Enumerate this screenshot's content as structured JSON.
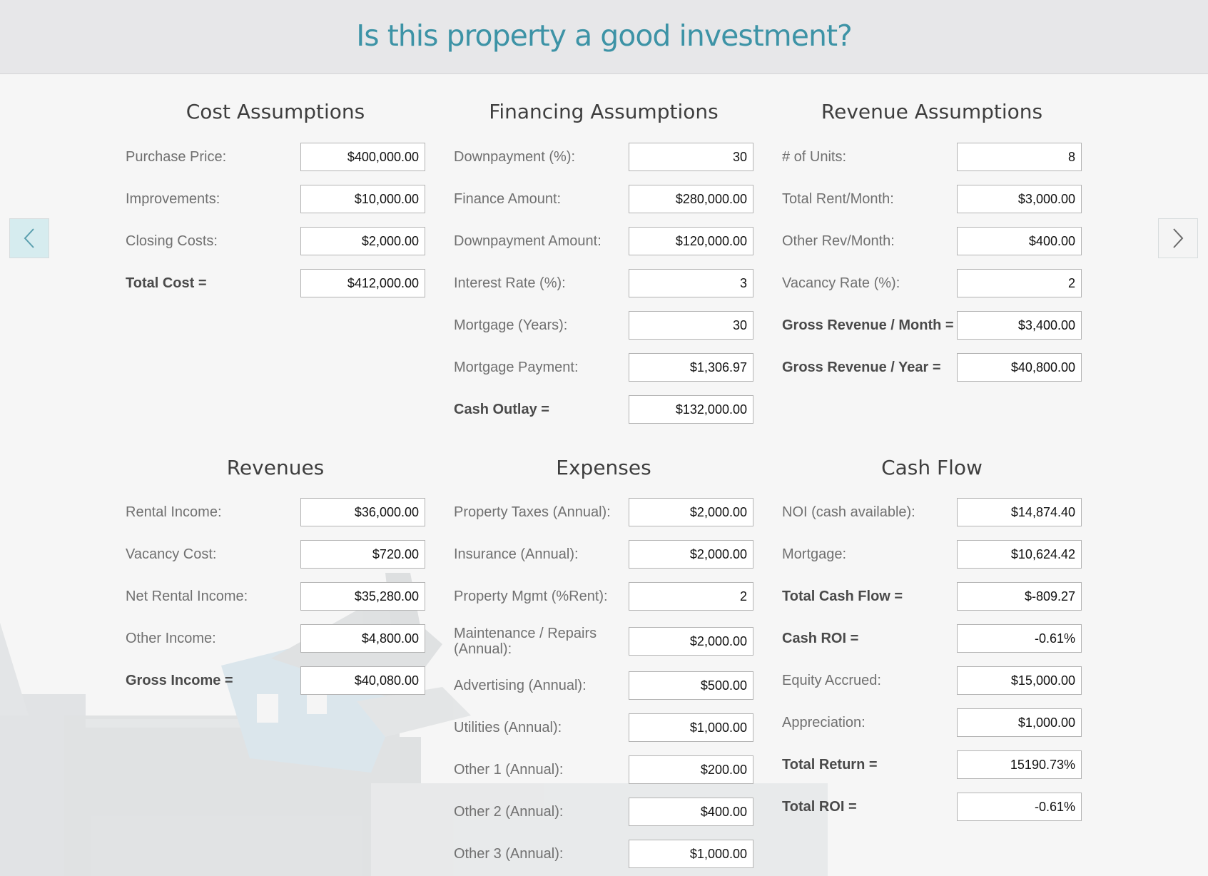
{
  "header": {
    "title": "Is this property a good investment?"
  },
  "cost": {
    "title": "Cost Assumptions",
    "rows": [
      {
        "label": "Purchase Price:",
        "value": "$400,000.00"
      },
      {
        "label": "Improvements:",
        "value": "$10,000.00"
      },
      {
        "label": "Closing Costs:",
        "value": "$2,000.00"
      },
      {
        "label": "Total Cost =",
        "value": "$412,000.00"
      }
    ]
  },
  "financing": {
    "title": "Financing Assumptions",
    "rows": [
      {
        "label": "Downpayment (%):",
        "value": "30"
      },
      {
        "label": "Finance Amount:",
        "value": "$280,000.00"
      },
      {
        "label": "Downpayment Amount:",
        "value": "$120,000.00"
      },
      {
        "label": "Interest Rate (%):",
        "value": "3"
      },
      {
        "label": "Mortgage (Years):",
        "value": "30"
      },
      {
        "label": "Mortgage Payment:",
        "value": "$1,306.97"
      },
      {
        "label": "Cash Outlay =",
        "value": "$132,000.00"
      }
    ]
  },
  "revenue_assumptions": {
    "title": "Revenue Assumptions",
    "rows": [
      {
        "label": "# of Units:",
        "value": "8"
      },
      {
        "label": "Total Rent/Month:",
        "value": "$3,000.00"
      },
      {
        "label": "Other Rev/Month:",
        "value": "$400.00"
      },
      {
        "label": "Vacancy Rate (%):",
        "value": "2"
      },
      {
        "label": "Gross Revenue / Month =",
        "value": "$3,400.00"
      },
      {
        "label": "Gross Revenue / Year =",
        "value": "$40,800.00"
      }
    ]
  },
  "revenues": {
    "title": "Revenues",
    "rows": [
      {
        "label": "Rental Income:",
        "value": "$36,000.00"
      },
      {
        "label": "Vacancy Cost:",
        "value": "$720.00"
      },
      {
        "label": "Net Rental Income:",
        "value": "$35,280.00"
      },
      {
        "label": "Other Income:",
        "value": "$4,800.00"
      },
      {
        "label": "Gross Income =",
        "value": "$40,080.00"
      }
    ]
  },
  "expenses": {
    "title": "Expenses",
    "rows": [
      {
        "label": "Property Taxes (Annual):",
        "value": "$2,000.00"
      },
      {
        "label": "Insurance (Annual):",
        "value": "$2,000.00"
      },
      {
        "label": "Property Mgmt (%Rent):",
        "value": "2"
      },
      {
        "label": "Maintenance / Repairs (Annual):",
        "value": "$2,000.00"
      },
      {
        "label": "Advertising (Annual):",
        "value": "$500.00"
      },
      {
        "label": "Utilities (Annual):",
        "value": "$1,000.00"
      },
      {
        "label": "Other 1 (Annual):",
        "value": "$200.00"
      },
      {
        "label": "Other 2 (Annual):",
        "value": "$400.00"
      },
      {
        "label": "Other 3 (Annual):",
        "value": "$1,000.00"
      }
    ]
  },
  "cash_flow": {
    "title": "Cash Flow",
    "rows": [
      {
        "label": "NOI (cash available):",
        "value": "$14,874.40"
      },
      {
        "label": "Mortgage:",
        "value": "$10,624.42"
      },
      {
        "label": "Total Cash Flow =",
        "value": "$-809.27"
      },
      {
        "label": "Cash ROI =",
        "value": "-0.61%"
      },
      {
        "label": "Equity Accrued:",
        "value": "$15,000.00"
      },
      {
        "label": "Appreciation:",
        "value": "$1,000.00"
      },
      {
        "label": "Total Return =",
        "value": "15190.73%"
      },
      {
        "label": "Total ROI =",
        "value": "-0.61%"
      }
    ]
  },
  "icons": {
    "prev": "chevron-left-icon",
    "next": "chevron-right-icon"
  },
  "colors": {
    "title": "#3d93a6",
    "header_bg": "#e7e7e9",
    "page_bg": "#f6f6f6",
    "prev_button_bg": "#d6ecef"
  }
}
